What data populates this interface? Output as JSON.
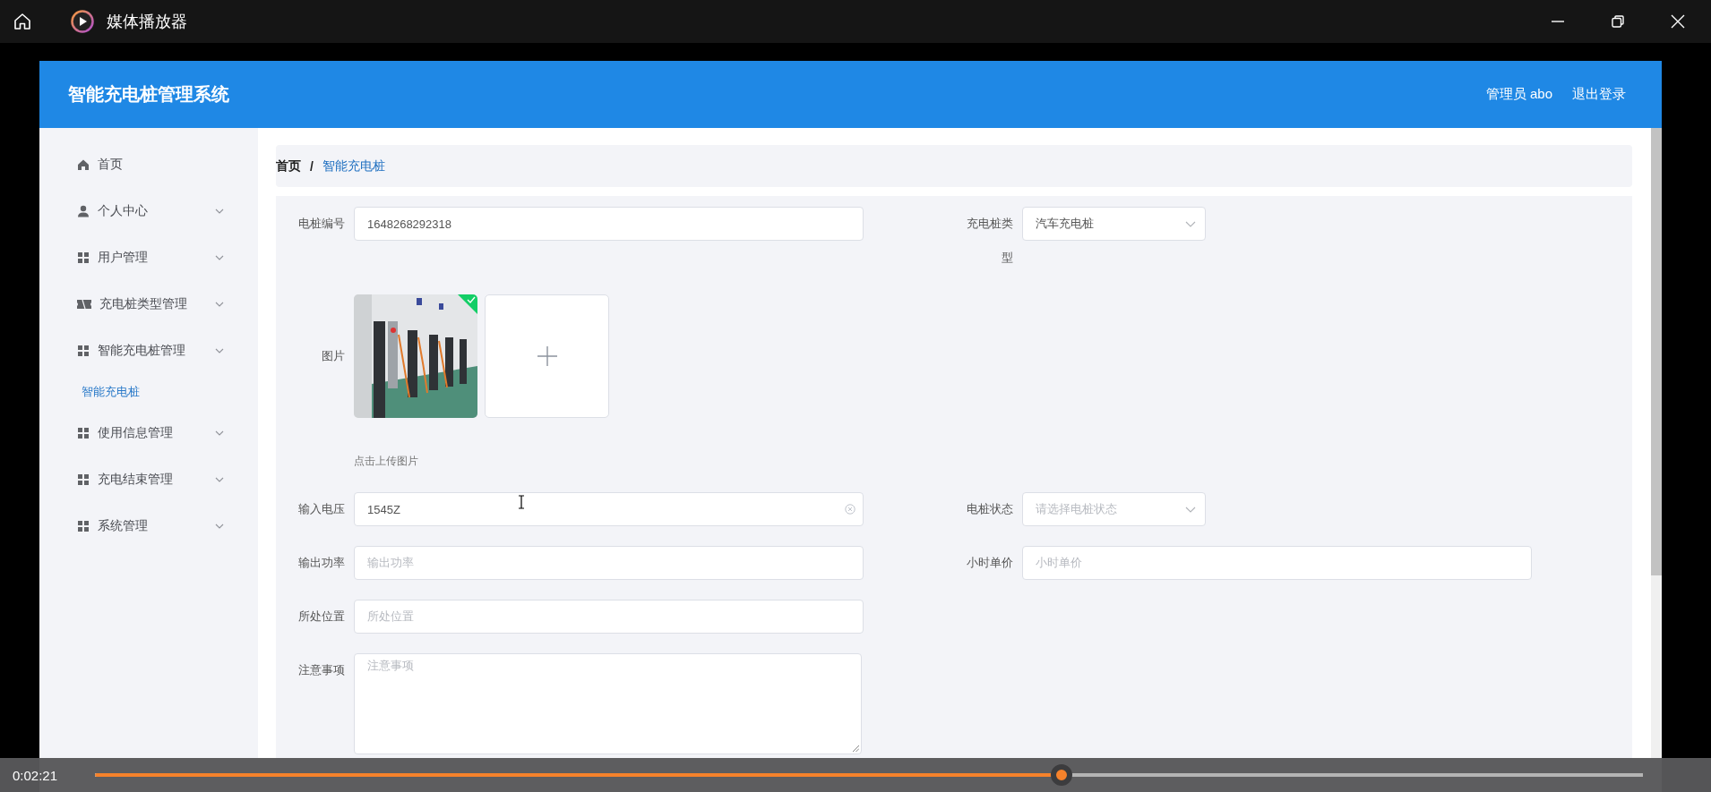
{
  "player": {
    "title": "媒体播放器",
    "time": "0:02:21",
    "progress": {
      "level": 0.62
    }
  },
  "app": {
    "title": "智能充电桩管理系统",
    "user": "管理员 abo",
    "logout": "退出登录"
  },
  "sidebar": {
    "items": [
      {
        "label": "首页",
        "kind": "home",
        "selected": false
      },
      {
        "label": "个人中心",
        "kind": "user",
        "selected": false
      },
      {
        "label": "用户管理",
        "kind": "grid",
        "selected": false
      },
      {
        "label": "充电桩类型管理",
        "kind": "ticket",
        "selected": false
      },
      {
        "label": "智能充电桩管理",
        "kind": "grid",
        "selected": false,
        "children": [
          {
            "label": "智能充电桩",
            "selected": true
          }
        ]
      },
      {
        "label": "使用信息管理",
        "kind": "grid",
        "selected": false
      },
      {
        "label": "充电结束管理",
        "kind": "grid",
        "selected": false
      },
      {
        "label": "系统管理",
        "kind": "grid",
        "selected": false
      }
    ]
  },
  "breadcrumb": {
    "separator": "/",
    "items": [
      {
        "label": "首页",
        "current": false
      },
      {
        "label": "智能充电桩",
        "current": true
      }
    ]
  },
  "form": {
    "rows": [
      {
        "items": [
          {
            "kind": "input",
            "label": "电桩编号",
            "value": "1648268292318"
          },
          {
            "kind": "select",
            "label": "充电桩类型",
            "value": "汽车充电桩"
          }
        ]
      },
      {
        "items": [
          {
            "kind": "upload",
            "label": "图片",
            "hint": "点击上传图片",
            "images": [
              {
                "kind": "picture",
                "success": true
              }
            ]
          }
        ]
      },
      {
        "items": [
          {
            "kind": "input",
            "label": "输入电压",
            "value": "1545Z",
            "clearable": true
          },
          {
            "kind": "select",
            "label": "电桩状态",
            "placeholder": "请选择电桩状态"
          }
        ]
      },
      {
        "items": [
          {
            "kind": "input",
            "label": "输出功率",
            "placeholder": "输出功率"
          },
          {
            "kind": "input",
            "label": "小时单价",
            "placeholder": "小时单价"
          }
        ]
      },
      {
        "items": [
          {
            "kind": "input",
            "label": "所处位置",
            "placeholder": "所处位置"
          }
        ]
      },
      {
        "items": [
          {
            "kind": "textarea",
            "label": "注意事项",
            "placeholder": "注意事项"
          }
        ]
      }
    ]
  }
}
